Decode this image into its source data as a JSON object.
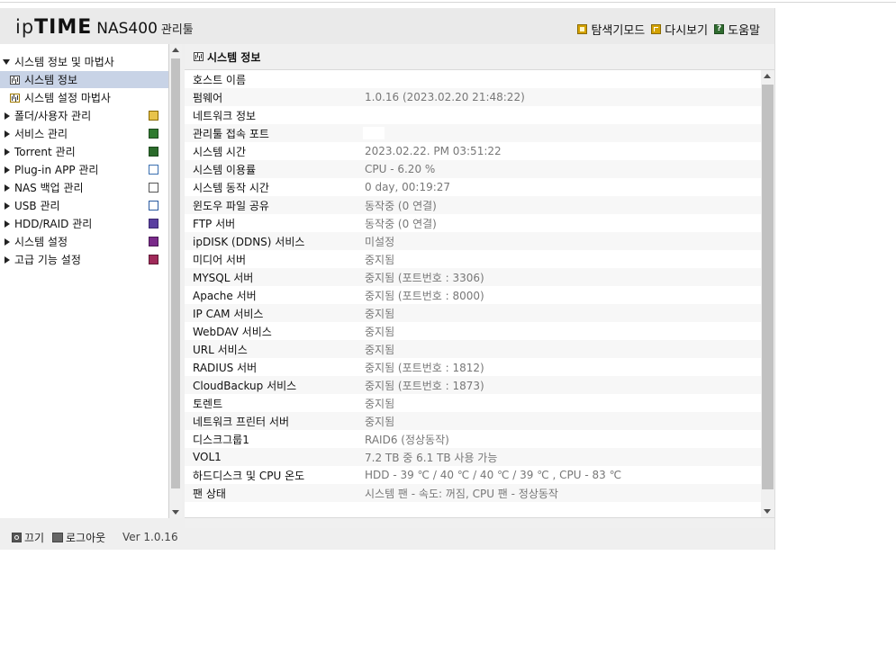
{
  "header": {
    "logo_ip": "ip",
    "logo_time": "TIME",
    "logo_model": "NAS400",
    "logo_suffix": "관리툴",
    "links": [
      {
        "label": "탐색기모드",
        "icon": "explorer-icon"
      },
      {
        "label": "다시보기",
        "icon": "refresh-icon"
      },
      {
        "label": "도움말",
        "icon": "help-icon"
      }
    ],
    "help_glyph": "?"
  },
  "sidebar": {
    "group_title": "시스템 정보 및 마법사",
    "sub_items": [
      {
        "label": "시스템 정보",
        "selected": true
      },
      {
        "label": "시스템 설정 마법사",
        "selected": false
      }
    ],
    "items": [
      {
        "label": "폴더/사용자 관리",
        "icon": "folder-user-icon"
      },
      {
        "label": "서비스 관리",
        "icon": "service-icon"
      },
      {
        "label": "Torrent 관리",
        "icon": "torrent-icon"
      },
      {
        "label": "Plug-in APP 관리",
        "icon": "plugin-icon"
      },
      {
        "label": "NAS 백업 관리",
        "icon": "backup-icon"
      },
      {
        "label": "USB 관리",
        "icon": "usb-icon"
      },
      {
        "label": "HDD/RAID 관리",
        "icon": "hdd-icon"
      },
      {
        "label": "시스템 설정",
        "icon": "system-settings-icon"
      },
      {
        "label": "고급 기능 설정",
        "icon": "advanced-settings-icon"
      }
    ]
  },
  "footer": {
    "power_label": "끄기",
    "logout_label": "로그아웃",
    "version": "Ver 1.0.16"
  },
  "main": {
    "title": "시스템 정보",
    "rows": [
      {
        "label": "호스트 이름",
        "value": ""
      },
      {
        "label": "펌웨어",
        "value": "1.0.16 (2023.02.20 21:48:22)"
      },
      {
        "label": "네트워크 정보",
        "value": ""
      },
      {
        "label": "관리툴 접속 포트",
        "value": ""
      },
      {
        "label": "시스템 시간",
        "value": "2023.02.22. PM 03:51:22"
      },
      {
        "label": "시스템 이용률",
        "value": "CPU - 6.20 %"
      },
      {
        "label": "시스템 동작 시간",
        "value": "0 day, 00:19:27"
      },
      {
        "label": "윈도우 파일 공유",
        "value": "동작중 (0 연결)"
      },
      {
        "label": "FTP 서버",
        "value": "동작중 (0 연결)"
      },
      {
        "label": "ipDISK (DDNS) 서비스",
        "value": "미설정"
      },
      {
        "label": "미디어 서버",
        "value": "중지됨"
      },
      {
        "label": "MYSQL 서버",
        "value": "중지됨 (포트번호 : 3306)"
      },
      {
        "label": "Apache 서버",
        "value": "중지됨 (포트번호 : 8000)"
      },
      {
        "label": "IP CAM 서비스",
        "value": "중지됨"
      },
      {
        "label": "WebDAV 서비스",
        "value": "중지됨"
      },
      {
        "label": "URL 서비스",
        "value": "중지됨"
      },
      {
        "label": "RADIUS 서버",
        "value": "중지됨 (포트번호 : 1812)"
      },
      {
        "label": "CloudBackup 서비스",
        "value": "중지됨 (포트번호 : 1873)"
      },
      {
        "label": "토렌트",
        "value": "중지됨"
      },
      {
        "label": "네트워크 프린터 서버",
        "value": "중지됨"
      },
      {
        "label": "디스크그룹1",
        "value": "RAID6 (정상동작)"
      },
      {
        "label": "VOL1",
        "value": "7.2 TB 중 6.1 TB 사용 가능"
      },
      {
        "label": "하드디스크 및 CPU 온도",
        "value": "HDD - 39 ℃ / 40 ℃ / 40 ℃ / 39 ℃ , CPU - 83 ℃"
      },
      {
        "label": "팬 상태",
        "value": "시스템 팬 - 속도: 꺼짐,  CPU 팬 - 정상동작"
      }
    ]
  }
}
